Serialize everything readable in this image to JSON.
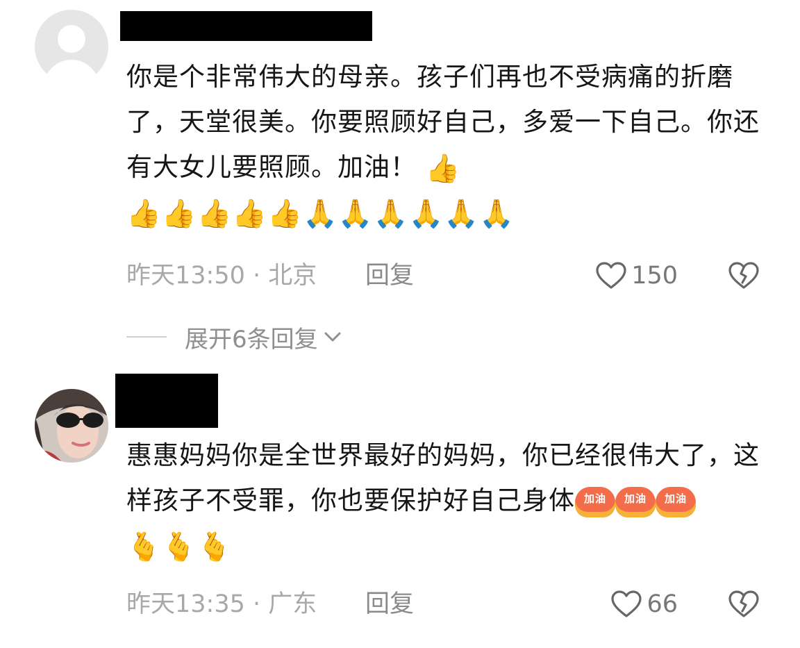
{
  "comments": [
    {
      "text": "你是个非常伟大的母亲。孩子们再也不受病痛的折磨了，天堂很美。你要照顾好自己，多爱一下自己。你还有大女儿要照顾。加油！",
      "emojis_line1": "👍",
      "emojis_line2": "👍👍👍👍👍🙏🙏🙏🙏🙏🙏",
      "time_location": "昨天13:50 · 北京",
      "reply_label": "回复",
      "like_count": "150",
      "expand_label": "展开6条回复"
    },
    {
      "text": "惠惠妈妈你是全世界最好的妈妈，你已经很伟大了，这样孩子不受罪，你也要保护好自己身体",
      "badge_text": "加油",
      "hand_hearts": "🫰🫰🫰",
      "time_location": "昨天13:35 · 广东",
      "reply_label": "回复",
      "like_count": "66"
    }
  ],
  "icons": {
    "like": "heart-outline-icon",
    "dislike": "broken-heart-icon",
    "expand": "chevron-down-icon",
    "default_avatar": "user-silhouette-icon"
  },
  "colors": {
    "meta_text": "#a8a8a8",
    "like_text": "#777777",
    "icon_stroke": "#666666"
  }
}
